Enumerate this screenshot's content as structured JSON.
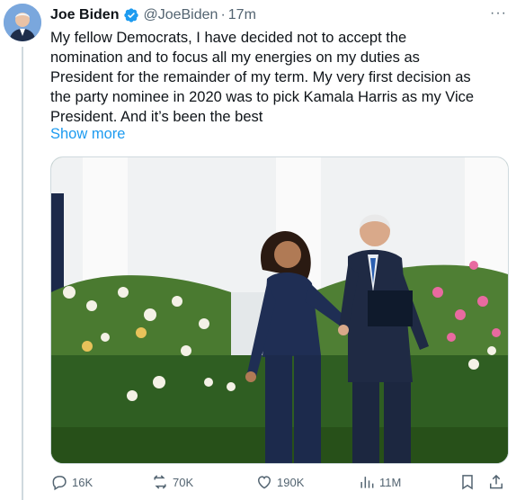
{
  "tweet": {
    "author_name": "Joe Biden",
    "handle": "@JoeBiden",
    "separator": "·",
    "time": "17m",
    "more_icon": "···",
    "text_lines": [
      "My fellow Democrats, I have decided not to accept the",
      "nomination and to focus all my energies on my duties as",
      "President for the remainder of my term. My very first decision as",
      "the party nominee in 2020 was to pick Kamala Harris as my Vice",
      "President. And it’s been the best"
    ],
    "show_more": "Show more"
  },
  "actions": {
    "replies": "16K",
    "reposts": "70K",
    "likes": "190K",
    "views": "11M"
  },
  "icons": {
    "verified": "verified-badge-icon",
    "reply": "reply-icon",
    "repost": "repost-icon",
    "like": "heart-icon",
    "views": "views-icon",
    "bookmark": "bookmark-icon",
    "share": "share-icon"
  },
  "colors": {
    "link": "#1d9bf0",
    "secondary_text": "#536471",
    "verified": "#1d9bf0"
  }
}
